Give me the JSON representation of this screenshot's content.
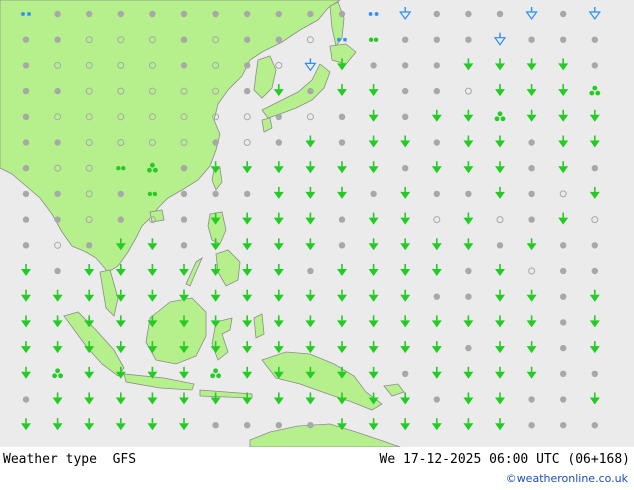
{
  "map": {
    "colors": {
      "sea": "#ebebeb",
      "land": "#b6f08c",
      "coast": "#8c8c8c",
      "rain_icon": "#22cc22",
      "snow_icon": "#2d8ff0",
      "cloud_icon": "#a8a8a8"
    },
    "legend_symbols": [
      "cloudy-dot",
      "partly-cloudy-circle",
      "clear-circle",
      "rain-shower",
      "thunderstorm",
      "drizzle",
      "snow",
      "snow-shower"
    ]
  },
  "footer": {
    "title": "Weather type",
    "model": "GFS",
    "valid_time": "We 17-12-2025 06:00 UTC (06+168)",
    "credit": "©weatheronline.co.uk"
  }
}
